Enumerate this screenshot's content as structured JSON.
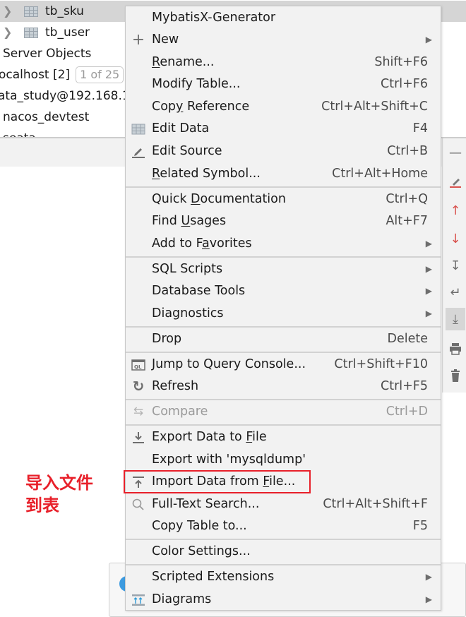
{
  "tree": {
    "items": [
      {
        "label": "tb_sku",
        "has_chevron": true,
        "has_table_icon": true,
        "selected": true
      },
      {
        "label": "tb_user",
        "has_chevron": true,
        "has_table_icon": true,
        "selected": false
      },
      {
        "label": "Server Objects"
      },
      {
        "label": "ocalhost [2]",
        "badge": "1 of 25"
      },
      {
        "label": "ata_study@192.168.1"
      },
      {
        "label": "nacos_devtest"
      },
      {
        "label": "seata"
      }
    ]
  },
  "annotation": {
    "line1": "导入文件",
    "line2": "到表",
    "color": "#e8202a"
  },
  "context_menu": {
    "items": [
      {
        "label": "MybatisX-Generator",
        "shortcut": "",
        "icon": "",
        "submenu": false
      },
      {
        "label": "New",
        "shortcut": "",
        "icon": "plus-icon",
        "submenu": true
      },
      {
        "label": "Rename...",
        "shortcut": "Shift+F6",
        "icon": "",
        "submenu": false,
        "mnemonic": "R"
      },
      {
        "label": "Modify Table...",
        "shortcut": "Ctrl+F6",
        "icon": "",
        "submenu": false
      },
      {
        "label": "Copy Reference",
        "shortcut": "Ctrl+Alt+Shift+C",
        "icon": "",
        "submenu": false,
        "mnemonic": "y"
      },
      {
        "label": "Edit Data",
        "shortcut": "F4",
        "icon": "table-icon",
        "submenu": false
      },
      {
        "label": "Edit Source",
        "shortcut": "Ctrl+B",
        "icon": "pencil-icon",
        "submenu": false
      },
      {
        "label": "Related Symbol...",
        "shortcut": "Ctrl+Alt+Home",
        "icon": "",
        "submenu": false,
        "mnemonic": "R"
      },
      {
        "label": "Quick Documentation",
        "shortcut": "Ctrl+Q",
        "icon": "",
        "submenu": false,
        "mnemonic": "D"
      },
      {
        "label": "Find Usages",
        "shortcut": "Alt+F7",
        "icon": "",
        "submenu": false,
        "mnemonic": "U"
      },
      {
        "label": "Add to Favorites",
        "shortcut": "",
        "icon": "",
        "submenu": true,
        "mnemonic": "a"
      },
      {
        "label": "SQL Scripts",
        "shortcut": "",
        "icon": "",
        "submenu": true
      },
      {
        "label": "Database Tools",
        "shortcut": "",
        "icon": "",
        "submenu": true
      },
      {
        "label": "Diagnostics",
        "shortcut": "",
        "icon": "",
        "submenu": true
      },
      {
        "label": "Drop",
        "shortcut": "Delete",
        "icon": "",
        "submenu": false
      },
      {
        "label": "Jump to Query Console...",
        "shortcut": "Ctrl+Shift+F10",
        "icon": "query-console-icon",
        "submenu": false
      },
      {
        "label": "Refresh",
        "shortcut": "Ctrl+F5",
        "icon": "refresh-icon",
        "submenu": false
      },
      {
        "label": "Compare",
        "shortcut": "Ctrl+D",
        "icon": "compare-icon",
        "submenu": false,
        "disabled": true
      },
      {
        "label": "Export Data to File",
        "shortcut": "",
        "icon": "download-icon",
        "submenu": false,
        "mnemonic": "F"
      },
      {
        "label": "Export with 'mysqldump'",
        "shortcut": "",
        "icon": "",
        "submenu": false
      },
      {
        "label": "Import Data from File...",
        "shortcut": "",
        "icon": "upload-icon",
        "submenu": false,
        "mnemonic": "F",
        "highlighted": true
      },
      {
        "label": "Full-Text Search...",
        "shortcut": "Ctrl+Alt+Shift+F",
        "icon": "search-icon",
        "submenu": false
      },
      {
        "label": "Copy Table to...",
        "shortcut": "F5",
        "icon": "",
        "submenu": false
      },
      {
        "label": "Color Settings...",
        "shortcut": "",
        "icon": "",
        "submenu": false
      },
      {
        "label": "Scripted Extensions",
        "shortcut": "",
        "icon": "",
        "submenu": true
      },
      {
        "label": "Diagrams",
        "shortcut": "",
        "icon": "diagram-icon",
        "submenu": true
      }
    ]
  },
  "right_toolbar": {
    "tools": [
      "collapse-icon",
      "edit-icon",
      "arrow-up-icon",
      "arrow-down-icon",
      "sort-icon",
      "wrap-icon",
      "scroll-to-end-icon",
      "print-icon",
      "trash-icon"
    ]
  },
  "colors": {
    "menu_bg": "#f2f2f2",
    "highlight_border": "#e8202a",
    "accent_red": "#d9534f"
  }
}
